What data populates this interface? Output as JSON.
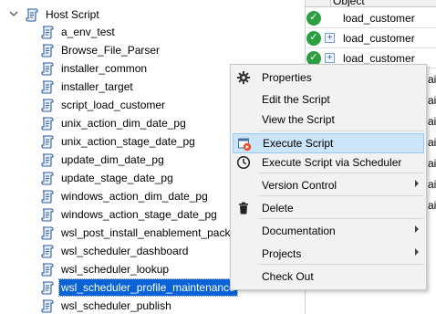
{
  "tree": {
    "root_label": "Host Script",
    "items": [
      {
        "label": "a_env_test"
      },
      {
        "label": "Browse_File_Parser"
      },
      {
        "label": "installer_common"
      },
      {
        "label": "installer_target"
      },
      {
        "label": "script_load_customer"
      },
      {
        "label": "unix_action_dim_date_pg"
      },
      {
        "label": "unix_action_stage_date_pg"
      },
      {
        "label": "update_dim_date_pg"
      },
      {
        "label": "update_stage_date_pg"
      },
      {
        "label": "windows_action_dim_date_pg"
      },
      {
        "label": "windows_action_stage_date_pg"
      },
      {
        "label": "wsl_post_install_enablement_pack"
      },
      {
        "label": "wsl_scheduler_dashboard"
      },
      {
        "label": "wsl_scheduler_lookup"
      },
      {
        "label": "wsl_scheduler_profile_maintenance"
      },
      {
        "label": "wsl_scheduler_publish"
      }
    ],
    "selected_index": 14
  },
  "grid": {
    "header_label": "Object",
    "rows": [
      {
        "status_icon": "check-circle-icon",
        "expandable": false,
        "text": "load_customer"
      },
      {
        "status_icon": "check-circle-icon",
        "expandable": true,
        "text": "load_customer"
      },
      {
        "status_icon": "check-circle-icon",
        "expandable": true,
        "text": "load_customer"
      }
    ],
    "partial_fragments": [
      "ain",
      "ain",
      "ain",
      "ain",
      "ain",
      "ain",
      "ain"
    ]
  },
  "context_menu": {
    "items": [
      {
        "label": "Properties",
        "icon": "gear-icon",
        "submenu": false
      },
      {
        "label": "Edit the Script",
        "icon": "",
        "submenu": false
      },
      {
        "label": "View the Script",
        "icon": "",
        "submenu": false
      },
      {
        "label": "Execute Script",
        "icon": "execute-script-icon",
        "submenu": false,
        "highlighted": true
      },
      {
        "label": "Execute Script via Scheduler",
        "icon": "clock-icon",
        "submenu": false
      },
      {
        "label": "Version Control",
        "icon": "",
        "submenu": true
      },
      {
        "label": "Delete",
        "icon": "trash-icon",
        "submenu": false
      },
      {
        "label": "Documentation",
        "icon": "",
        "submenu": true
      },
      {
        "label": "Projects",
        "icon": "",
        "submenu": true
      },
      {
        "label": "Check Out",
        "icon": "",
        "submenu": false
      }
    ]
  },
  "colors": {
    "selection": "#0a63d6",
    "menu_hover": "#cce4f7",
    "status_ok": "#2e9e44",
    "script_icon": "#2d5fa3"
  }
}
